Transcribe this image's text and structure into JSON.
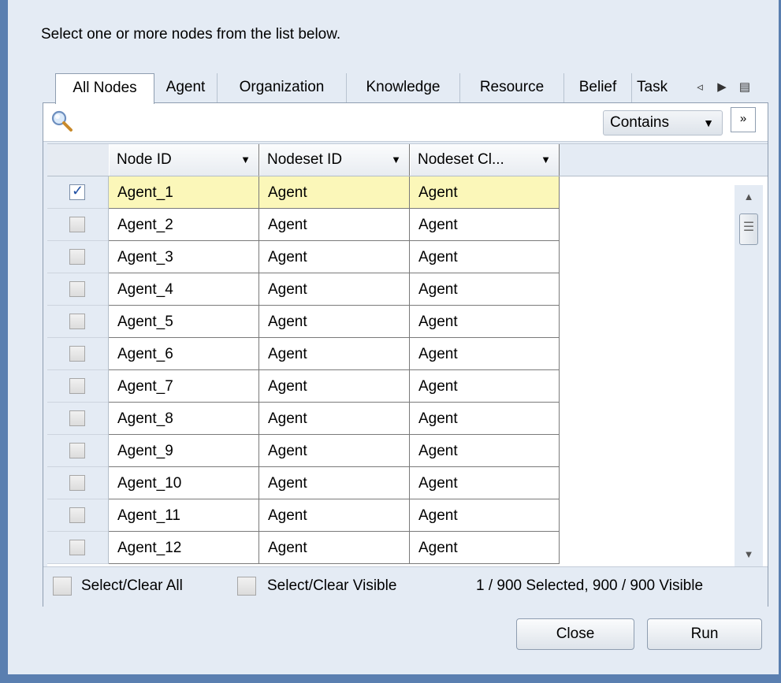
{
  "instruction": "Select one or more nodes from the list below.",
  "tabs": [
    {
      "label": "All Nodes",
      "active": true
    },
    {
      "label": "Agent"
    },
    {
      "label": "Organization"
    },
    {
      "label": "Knowledge"
    },
    {
      "label": "Resource"
    },
    {
      "label": "Belief"
    },
    {
      "label": "Task"
    }
  ],
  "tab_nav": {
    "prev_icon": "◃",
    "next_icon": "▶",
    "menu_icon": "▤"
  },
  "search": {
    "value": "",
    "placeholder": "",
    "icon": "search-icon",
    "mode": "Contains",
    "expand_icon": "»"
  },
  "table": {
    "columns": [
      "Node ID",
      "Nodeset ID",
      "Nodeset Cl..."
    ],
    "rows": [
      {
        "id": "Agent_1",
        "nodeset": "Agent",
        "class": "Agent",
        "checked": true
      },
      {
        "id": "Agent_2",
        "nodeset": "Agent",
        "class": "Agent",
        "checked": false
      },
      {
        "id": "Agent_3",
        "nodeset": "Agent",
        "class": "Agent",
        "checked": false
      },
      {
        "id": "Agent_4",
        "nodeset": "Agent",
        "class": "Agent",
        "checked": false
      },
      {
        "id": "Agent_5",
        "nodeset": "Agent",
        "class": "Agent",
        "checked": false
      },
      {
        "id": "Agent_6",
        "nodeset": "Agent",
        "class": "Agent",
        "checked": false
      },
      {
        "id": "Agent_7",
        "nodeset": "Agent",
        "class": "Agent",
        "checked": false
      },
      {
        "id": "Agent_8",
        "nodeset": "Agent",
        "class": "Agent",
        "checked": false
      },
      {
        "id": "Agent_9",
        "nodeset": "Agent",
        "class": "Agent",
        "checked": false
      },
      {
        "id": "Agent_10",
        "nodeset": "Agent",
        "class": "Agent",
        "checked": false
      },
      {
        "id": "Agent_11",
        "nodeset": "Agent",
        "class": "Agent",
        "checked": false
      },
      {
        "id": "Agent_12",
        "nodeset": "Agent",
        "class": "Agent",
        "checked": false
      }
    ]
  },
  "footer": {
    "select_all_label": "Select/Clear All",
    "select_visible_label": "Select/Clear Visible",
    "status": "1 / 900 Selected, 900 / 900 Visible"
  },
  "buttons": {
    "close": "Close",
    "run": "Run"
  },
  "colors": {
    "selected_row": "#fbf7b9",
    "window_border": "#5a7fb0"
  }
}
